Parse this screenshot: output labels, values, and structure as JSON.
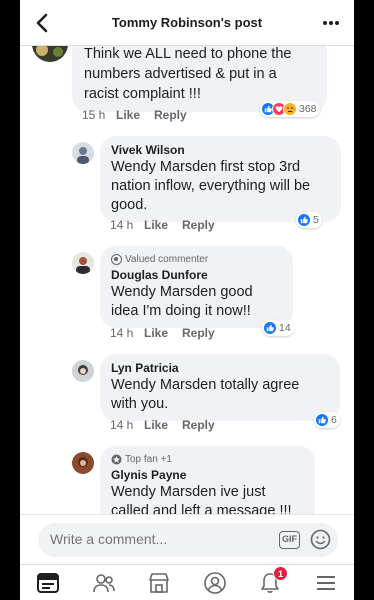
{
  "header": {
    "title": "Tommy Robinson's post"
  },
  "comments": [
    {
      "name": "",
      "badge": "",
      "text": "Think we ALL need to phone the numbers advertised & put in a racist complaint !!!",
      "time": "15 h",
      "like": "Like",
      "reply": "Reply",
      "reactions": "368",
      "reaction_icons": [
        "like",
        "love",
        "angry"
      ]
    },
    {
      "name": "Vivek Wilson",
      "badge": "",
      "text": "Wendy Marsden first stop 3rd nation inflow, everything will be good.",
      "time": "14 h",
      "like": "Like",
      "reply": "Reply",
      "reactions": "5",
      "reaction_icons": [
        "like"
      ]
    },
    {
      "name": "Douglas Dunfore",
      "badge": "Valued commenter",
      "text": "Wendy Marsden good idea I'm doing it now!!",
      "time": "14 h",
      "like": "Like",
      "reply": "Reply",
      "reactions": "14",
      "reaction_icons": [
        "like"
      ]
    },
    {
      "name": "Lyn Patricia",
      "badge": "",
      "text": "Wendy Marsden totally agree with you.",
      "time": "14 h",
      "like": "Like",
      "reply": "Reply",
      "reactions": "6",
      "reaction_icons": [
        "like"
      ]
    },
    {
      "name": "Glynis Payne",
      "badge": "Top fan +1",
      "text": "Wendy Marsden ive just called and left a message !!!",
      "time": "",
      "like": "",
      "reply": "",
      "reactions": "",
      "reaction_icons": []
    }
  ],
  "composer": {
    "placeholder": "Write a comment...",
    "gif_label": "GIF"
  },
  "tabbar": {
    "items": [
      "news-feed",
      "friends",
      "marketplace",
      "profile",
      "notifications",
      "menu"
    ],
    "notifications_count": "1"
  },
  "colors": {
    "like_blue": "#1877f2",
    "love_red": "#f33e58",
    "angry_orange": "#f7b125",
    "badge_red": "#e41e3f"
  }
}
